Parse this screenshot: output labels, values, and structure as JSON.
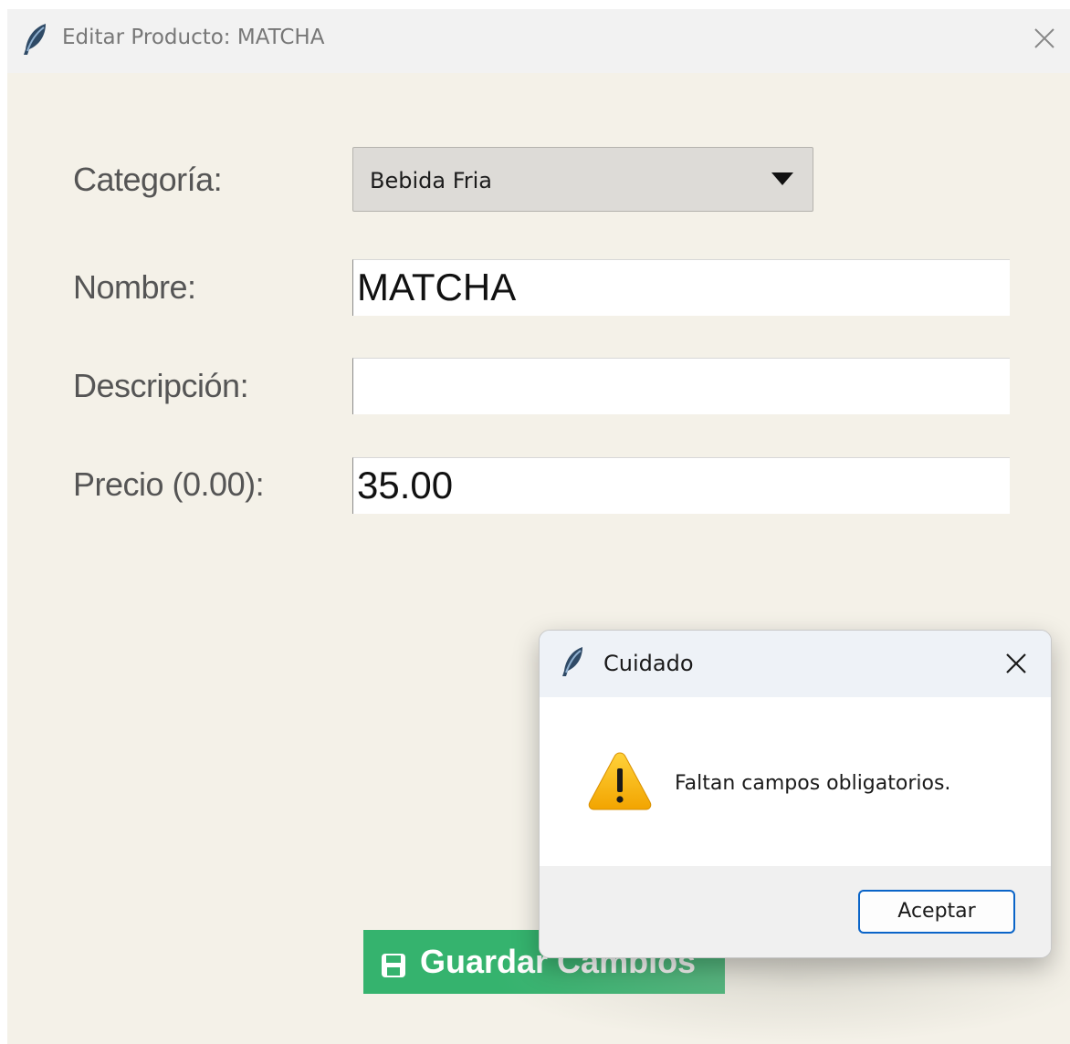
{
  "window": {
    "title": "Editar Producto: MATCHA",
    "icons": {
      "app": "feather-icon",
      "close": "close-icon"
    }
  },
  "form": {
    "categoria_label": "Categoría:",
    "categoria_value": "Bebida Fria",
    "nombre_label": "Nombre:",
    "nombre_value": "MATCHA",
    "descripcion_label": "Descripción:",
    "descripcion_value": "",
    "precio_label": "Precio (0.00):",
    "precio_value": "35.00",
    "save_label": "Guardar Cambios",
    "save_icon": "save-icon",
    "colors": {
      "background": "#f4f1e8",
      "save_button": "#35b36e"
    }
  },
  "dialog": {
    "title": "Cuidado",
    "message": "Faltan campos obligatorios.",
    "button_label": "Aceptar",
    "icons": {
      "app": "feather-icon",
      "warning": "warning-icon",
      "close": "close-icon"
    },
    "colors": {
      "warning": "#f5b301",
      "button_border": "#0a64c8"
    }
  }
}
